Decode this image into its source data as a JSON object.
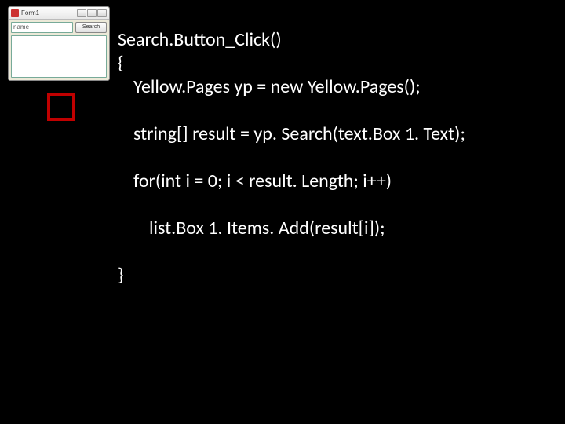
{
  "mockup": {
    "title": "Form1",
    "textbox_placeholder": "name",
    "button_label": "Search"
  },
  "code": {
    "l1": "Search.Button_Click()",
    "l2": "{",
    "l3": "Yellow.Pages yp = new Yellow.Pages();",
    "l4": "string[] result = yp. Search(text.Box 1. Text);",
    "l5": "for(int i = 0; i < result. Length; i++)",
    "l6": "list.Box 1. Items. Add(result[i]);",
    "l7": "}"
  }
}
